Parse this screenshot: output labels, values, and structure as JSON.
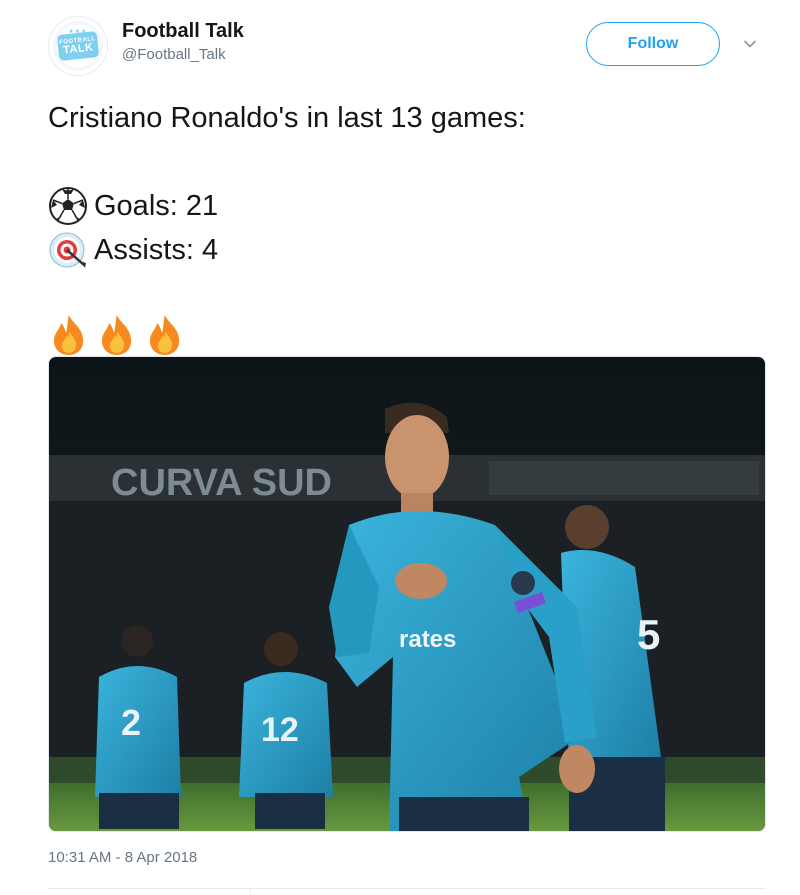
{
  "author": {
    "display_name": "Football Talk",
    "handle": "@Football_Talk",
    "avatar_logo_top": "FOOTBALL",
    "avatar_logo_main": "TALK"
  },
  "actions": {
    "follow_label": "Follow",
    "more_icon": "chevron-down-icon"
  },
  "tweet": {
    "headline": "Cristiano Ronaldo's in last 13 games:",
    "stats": [
      {
        "icon": "soccer-ball-icon",
        "text": "Goals: 21"
      },
      {
        "icon": "target-icon",
        "text": "Assists: 4"
      }
    ],
    "reaction_icons": [
      "fire-icon",
      "fire-icon",
      "fire-icon"
    ]
  },
  "photo": {
    "banner_text": "CURVA SUD",
    "shirt_sponsor": "rates",
    "player_numbers": [
      "2",
      "12",
      "5"
    ]
  },
  "timestamp": "10:31 AM - 8 Apr 2018",
  "colors": {
    "accent": "#1da1f2",
    "text_primary": "#14171a",
    "text_secondary": "#657786",
    "kit": "#2aa0c8"
  }
}
